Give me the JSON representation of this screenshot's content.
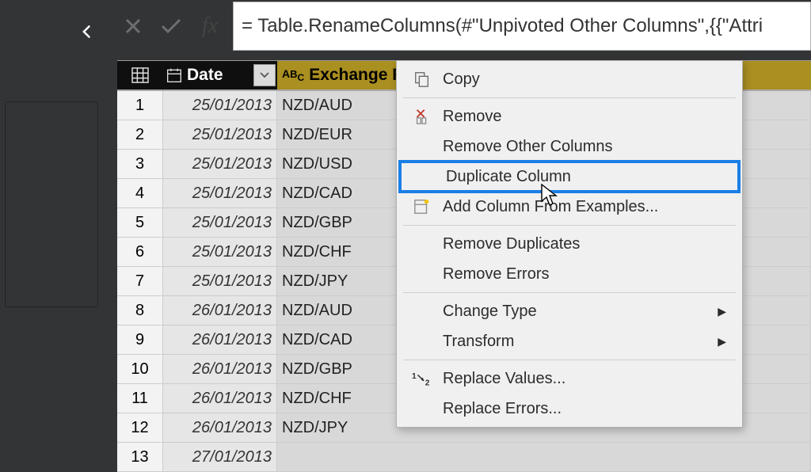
{
  "formula": "= Table.RenameColumns(#\"Unpivoted Other Columns\",{{\"Attri",
  "columns": {
    "date_label": "Date",
    "exchange_label": "Exchange R"
  },
  "rows": [
    {
      "n": "1",
      "date": "25/01/2013",
      "ex": "NZD/AUD"
    },
    {
      "n": "2",
      "date": "25/01/2013",
      "ex": "NZD/EUR"
    },
    {
      "n": "3",
      "date": "25/01/2013",
      "ex": "NZD/USD"
    },
    {
      "n": "4",
      "date": "25/01/2013",
      "ex": "NZD/CAD"
    },
    {
      "n": "5",
      "date": "25/01/2013",
      "ex": "NZD/GBP"
    },
    {
      "n": "6",
      "date": "25/01/2013",
      "ex": "NZD/CHF"
    },
    {
      "n": "7",
      "date": "25/01/2013",
      "ex": "NZD/JPY"
    },
    {
      "n": "8",
      "date": "26/01/2013",
      "ex": "NZD/AUD"
    },
    {
      "n": "9",
      "date": "26/01/2013",
      "ex": "NZD/CAD"
    },
    {
      "n": "10",
      "date": "26/01/2013",
      "ex": "NZD/GBP"
    },
    {
      "n": "11",
      "date": "26/01/2013",
      "ex": "NZD/CHF"
    },
    {
      "n": "12",
      "date": "26/01/2013",
      "ex": "NZD/JPY"
    },
    {
      "n": "13",
      "date": "27/01/2013",
      "ex": ""
    }
  ],
  "ctx": {
    "copy": "Copy",
    "remove": "Remove",
    "remove_other": "Remove Other Columns",
    "duplicate": "Duplicate Column",
    "add_examples": "Add Column From Examples...",
    "remove_dups": "Remove Duplicates",
    "remove_errors": "Remove Errors",
    "change_type": "Change Type",
    "transform": "Transform",
    "replace_values": "Replace Values...",
    "replace_errors": "Replace Errors..."
  }
}
